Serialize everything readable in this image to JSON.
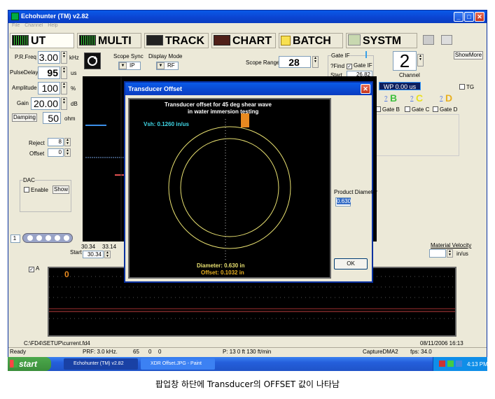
{
  "window": {
    "title": "Echohunter (TM) v2.82",
    "menu": [
      "File",
      "Channel",
      "Help"
    ]
  },
  "modes": [
    "UT",
    "MULTI",
    "TRACK",
    "CHART",
    "BATCH",
    "SYSTM"
  ],
  "show_more_label": "ShowMore",
  "left_panel": {
    "prf_label": "P.R.Freq",
    "prf_value": "3.00",
    "prf_unit": "kHz",
    "pulse_delay_label": "PulseDelay",
    "pulse_delay_value": "95",
    "pulse_delay_unit": "us",
    "amplitude_label": "Amplitude",
    "amplitude_value": "100",
    "amplitude_unit": "%",
    "gain_label": "Gain",
    "gain_value": "20.00",
    "gain_unit": "dB",
    "damping_label": "Damping",
    "damping_value": "50",
    "damping_unit": "ohm",
    "reject_label": "Reject",
    "reject_value": "8",
    "offset_label": "Offset",
    "offset_value": "0",
    "dac_label": "DAC",
    "dac_enable_label": "Enable",
    "dac_show_label": "Show",
    "page_value": "1"
  },
  "scope_sync": {
    "label": "Scope Sync",
    "value": "IP"
  },
  "display_mode": {
    "label": "Display Mode",
    "value": "RF"
  },
  "scope_range": {
    "label": "Scope Range",
    "value": "28"
  },
  "gate_if": {
    "label": "Gate IF",
    "find_label": "?Find",
    "gate_if_check_label": "Gate IF",
    "start_label": "Start",
    "start_value": "26.82"
  },
  "channel": {
    "value": "2",
    "label": "Channel"
  },
  "wp_label": "WP 0.00 us",
  "tg_label": "TG",
  "gates": [
    {
      "letter": "B",
      "color": "#40c040",
      "label": "Gate B"
    },
    {
      "letter": "C",
      "color": "#e8e020",
      "label": "Gate C"
    },
    {
      "letter": "D",
      "color": "#e8b020",
      "label": "Gate D"
    }
  ],
  "gate_help_label": "?",
  "scope_axis": {
    "left_value": "30.34",
    "right_value": "33.14",
    "start_label": "Start",
    "start_value": "30.34"
  },
  "material_velocity": {
    "label": "Material Velocity",
    "unit": "in/us"
  },
  "a_scan": {
    "check_label": "A",
    "marker": "0"
  },
  "file_path": "C:\\FD4\\SETUP\\current.fd4",
  "datetime": "08/11/2006 16:13",
  "status_bar": {
    "ready": "Ready",
    "prf": "PRF: 3.0 kHz.",
    "n1": "65",
    "n2": "0",
    "n3": "0",
    "position": "P: 13    0 ft   130 ft/min",
    "capture": "CaptureDMA2",
    "fps": "fps: 34.0"
  },
  "dialog": {
    "title": "Transducer Offset",
    "heading_line1": "Transducer offset for 45 deg shear wave",
    "heading_line2": "in water immersion testing",
    "vsh_text": "Vsh:  0.1260 in/us",
    "diameter_text": "Diameter:  0.630 in",
    "offset_text": "Offset:  0.1032 in",
    "product_diameter_label": "Product Diameter",
    "product_diameter_value": "0.630",
    "ok_label": "OK"
  },
  "taskbar": {
    "start_label": "start",
    "items": [
      "Echohunter (TM) v2.82",
      "XDR Offset.JPG - Paint"
    ],
    "clock": "4:13 PM"
  },
  "caption": "팝업창 하단에 Transducer의 OFFSET 값이 나타남",
  "colors": {
    "title_blue": "#0a3cc0",
    "scope_bg": "#000000",
    "circle": "#e8e070",
    "vsh_cyan": "#40d8e8",
    "probe_orange": "#e88a20"
  }
}
